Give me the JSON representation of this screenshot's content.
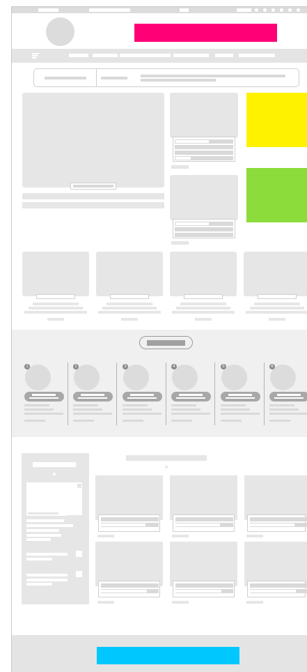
{
  "colors": {
    "ad_top": "#ff0077",
    "ad_yellow": "#fff200",
    "ad_green": "#8cdc3c",
    "ad_bottom": "#00c8ff"
  },
  "icons": {
    "menu": "hamburger-icon",
    "logo": "logo-circle"
  },
  "carousel": {
    "badges": [
      "1",
      "2",
      "3",
      "4",
      "5",
      "6"
    ]
  }
}
